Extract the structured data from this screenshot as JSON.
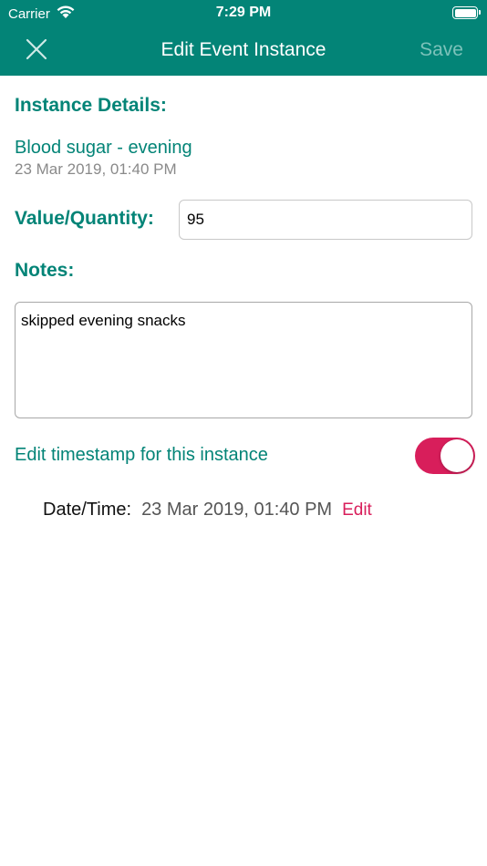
{
  "status_bar": {
    "carrier": "Carrier",
    "time": "7:29 PM",
    "wifi_icon": "wifi-icon",
    "battery_icon": "battery-icon"
  },
  "nav": {
    "title": "Edit Event Instance",
    "close_icon": "close-icon",
    "save_label": "Save"
  },
  "details": {
    "heading": "Instance Details:",
    "event_name": "Blood sugar - evening",
    "event_time": "23 Mar 2019, 01:40 PM"
  },
  "value": {
    "label": "Value/Quantity:",
    "input_value": "95"
  },
  "notes": {
    "label": "Notes:",
    "text": "skipped evening snacks"
  },
  "timestamp": {
    "toggle_label": "Edit timestamp for this instance",
    "toggle_on": true,
    "date_time_label": "Date/Time:",
    "date_time_value": "23 Mar 2019, 01:40 PM",
    "edit_label": "Edit"
  },
  "colors": {
    "primary": "#038477",
    "accent": "#d81e5b",
    "save_disabled": "#7cc2ba"
  }
}
